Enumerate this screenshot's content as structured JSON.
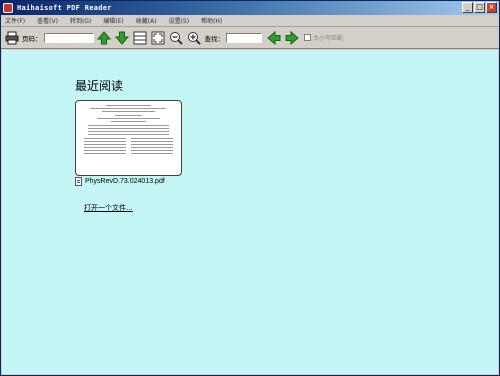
{
  "window": {
    "title": "Haihaisoft PDF Reader"
  },
  "menu": [
    "文件(F)",
    "查看(V)",
    "转到(G)",
    "编辑(E)",
    "收藏(A)",
    "设置(S)",
    "帮助(H)"
  ],
  "toolbar": {
    "page_label": "页码：",
    "page_value": "",
    "search_label": "查找：",
    "search_value": "",
    "match_case_label": "大小写匹配"
  },
  "main": {
    "recent_title": "最近阅读",
    "recent_files": [
      {
        "name": "PhysRevD.73.024013.pdf"
      }
    ],
    "open_file_link": "打开一个文件..."
  }
}
